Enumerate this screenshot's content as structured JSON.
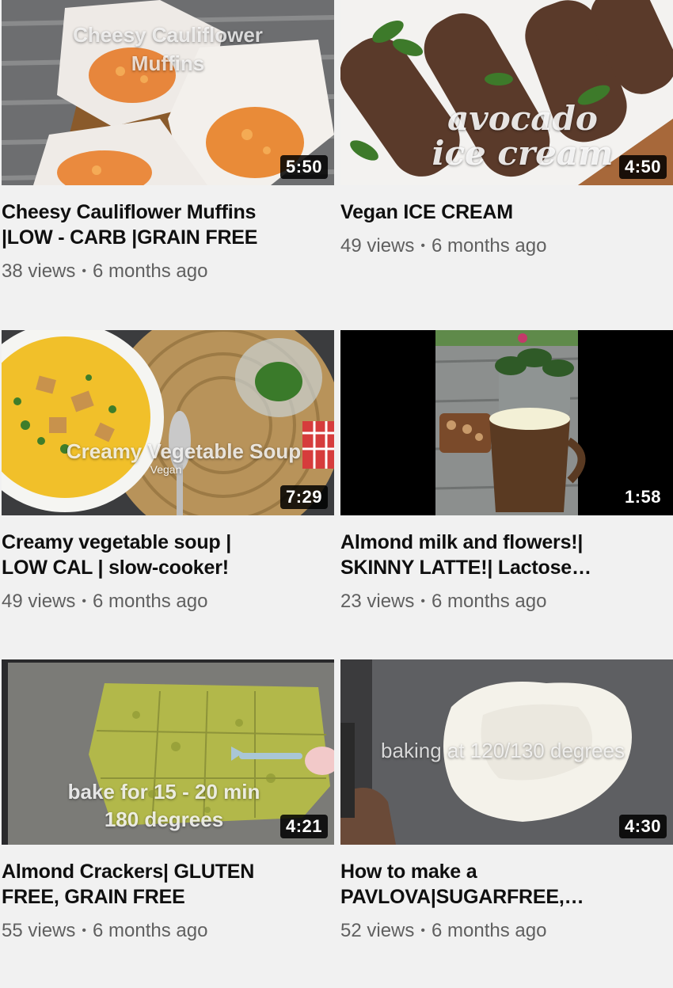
{
  "videos": [
    {
      "title": "Cheesy Cauliflower Muffins\n|LOW - CARB |GRAIN FREE",
      "views": "38 views",
      "age": "6 months ago",
      "duration": "5:50",
      "thumb_text": "Cheesy Cauliflower\nMuffins"
    },
    {
      "title": "Vegan ICE CREAM",
      "views": "49 views",
      "age": "6 months ago",
      "duration": "4:50",
      "thumb_text": "avocado\nice cream"
    },
    {
      "title": "Creamy vegetable soup |\nLOW CAL | slow-cooker!",
      "views": "49 views",
      "age": "6 months ago",
      "duration": "7:29",
      "thumb_text": "Creamy Vegetable Soup",
      "thumb_subtext": "Vegan"
    },
    {
      "title": "Almond milk and flowers!|\nSKINNY LATTE!| Lactose…",
      "views": "23 views",
      "age": "6 months ago",
      "duration": "1:58"
    },
    {
      "title": "Almond Crackers| GLUTEN\nFREE, GRAIN FREE",
      "views": "55 views",
      "age": "6 months ago",
      "duration": "4:21",
      "thumb_text": "bake for 15 - 20 min\n180 degrees"
    },
    {
      "title": "How to make a\nPAVLOVA|SUGARFREE,…",
      "views": "52 views",
      "age": "6 months ago",
      "duration": "4:30",
      "thumb_text": "baking at 120/130 degrees"
    }
  ],
  "separator": "•",
  "colors": {
    "page_background": "#f1f1f1",
    "title_text": "#0f0f0f",
    "meta_text": "#606060",
    "duration_badge": "#000000"
  }
}
